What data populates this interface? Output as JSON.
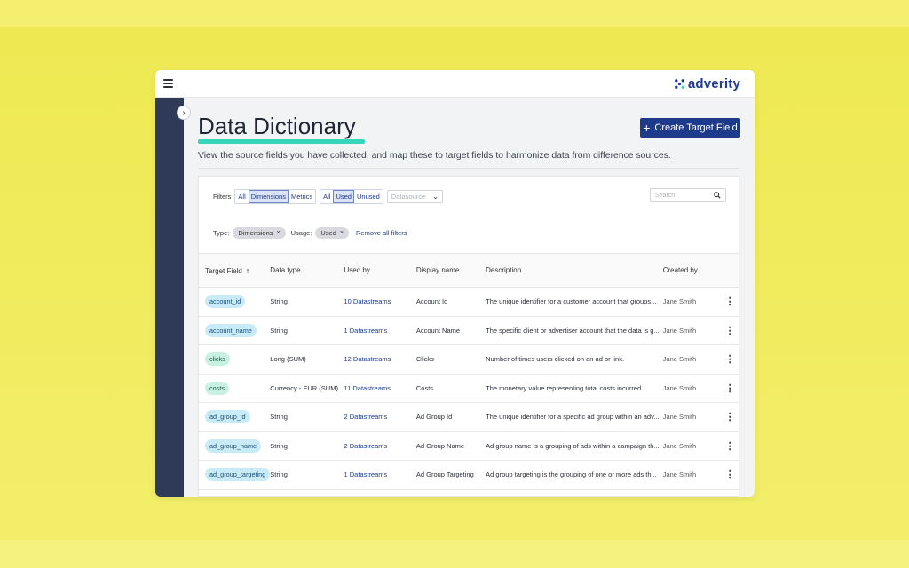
{
  "brand": {
    "name": "adverity",
    "color": "#1f3a93"
  },
  "header": {
    "menu_icon": "hamburger-icon"
  },
  "page": {
    "title": "Data Dictionary",
    "subtitle": "View the source fields you have collected, and map these to target fields to harmonize data from difference sources.",
    "create_button": "Create Target Field"
  },
  "filters": {
    "label": "Filters",
    "type_options": [
      "All",
      "Dimensions",
      "Metrics"
    ],
    "type_selected": "Dimensions",
    "usage_options": [
      "All",
      "Used",
      "Unused"
    ],
    "usage_selected": "Used",
    "datasource_placeholder": "Datasource",
    "search_placeholder": "Search"
  },
  "active_filters": {
    "type_label": "Type:",
    "type_value": "Dimensions",
    "usage_label": "Usage:",
    "usage_value": "Used",
    "remove_all": "Remove all filters"
  },
  "table": {
    "columns": [
      "Target Field",
      "Data type",
      "Used by",
      "Display name",
      "Description",
      "Created by"
    ],
    "rows": [
      {
        "field": "account_id",
        "type": "String",
        "used_by": "10 Datastreams",
        "display": "Account Id",
        "description": "The unique identifier for a customer account that groups...",
        "created_by": "Jane Smith",
        "pill": "blue"
      },
      {
        "field": "account_name",
        "type": "String",
        "used_by": "1 Datastreams",
        "display": "Account Name",
        "description": "The specific client or advertiser account that the data is g...",
        "created_by": "Jane Smith",
        "pill": "blue"
      },
      {
        "field": "clicks",
        "type": "Long (SUM)",
        "used_by": "12 Datastreams",
        "display": "Clicks",
        "description": "Number of times users clicked on an ad or link.",
        "created_by": "Jane Smith",
        "pill": "green"
      },
      {
        "field": "costs",
        "type": "Currency - EUR (SUM)",
        "used_by": "11 Datastreams",
        "display": "Costs",
        "description": "The monetary value representing total costs incurred.",
        "created_by": "Jane Smith",
        "pill": "green"
      },
      {
        "field": "ad_group_id",
        "type": "String",
        "used_by": "2 Datastreams",
        "display": "Ad Group Id",
        "description": "The unique identifier for a specific ad group within an adv...",
        "created_by": "Jane Smith",
        "pill": "blue"
      },
      {
        "field": "ad_group_name",
        "type": "String",
        "used_by": "2 Datastreams",
        "display": "Ad Group Name",
        "description": "Ad group name is a grouping of ads within a campaign th...",
        "created_by": "Jane Smith",
        "pill": "blue"
      },
      {
        "field": "ad_group_targeting",
        "type": "String",
        "used_by": "1 Datastreams",
        "display": "Ad Group Targeting",
        "description": "Ad group targeting is the grouping of one or more ads th...",
        "created_by": "Jane Smith",
        "pill": "blue"
      }
    ]
  },
  "colors": {
    "accent": "#1e3a8a",
    "underline": "#35d6b9",
    "sidebar": "#2e3a57",
    "background": "#eee952"
  }
}
